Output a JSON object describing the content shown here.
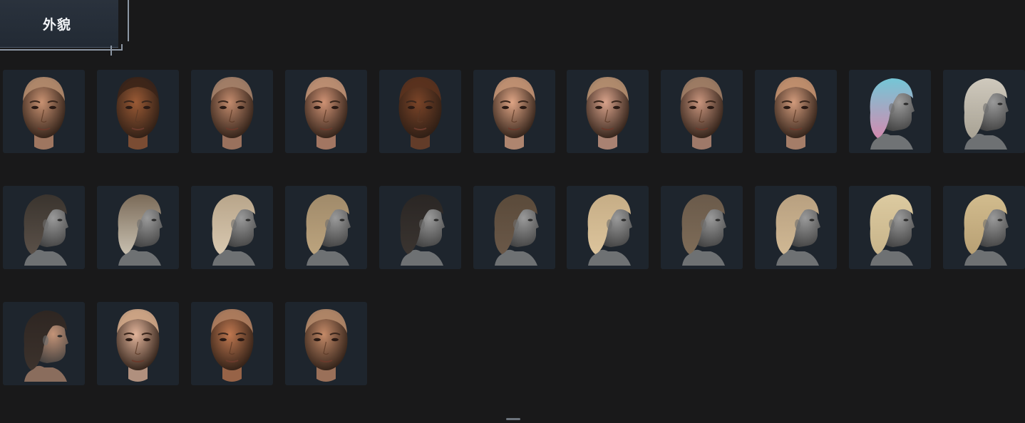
{
  "header": {
    "title": "外貌"
  },
  "colors": {
    "background": "#19191a",
    "tile": "#1e252d",
    "tab": "#262e38",
    "accent_line": "#8c96a3"
  },
  "rows": [
    {
      "name": "faces-row-1",
      "tiles": [
        {
          "kind": "face-front",
          "skin": "#c99272",
          "hair": "#b48c6e",
          "label_name": "head-option-1"
        },
        {
          "kind": "face-front",
          "skin": "#9a5a35",
          "hair": "#3a2418",
          "label_name": "head-option-2"
        },
        {
          "kind": "face-front",
          "skin": "#c38b6d",
          "hair": "#a5826a",
          "label_name": "head-option-3"
        },
        {
          "kind": "face-front",
          "skin": "#cf9274",
          "hair": "#c09276",
          "label_name": "head-option-4"
        },
        {
          "kind": "face-front",
          "skin": "#7a4428",
          "hair": "#5a321e",
          "label_name": "head-option-5"
        },
        {
          "kind": "face-front",
          "skin": "#dfa585",
          "hair": "#c39474",
          "label_name": "head-option-6"
        },
        {
          "kind": "face-front",
          "skin": "#d8a28a",
          "hair": "#b58f70",
          "label_name": "head-option-7"
        },
        {
          "kind": "face-front",
          "skin": "#c9957d",
          "hair": "#a07e66",
          "label_name": "head-option-8"
        },
        {
          "kind": "face-front",
          "skin": "#d29b7c",
          "hair": "#c49270",
          "label_name": "head-option-9"
        },
        {
          "kind": "hair-side",
          "skin": "#9c9c9c",
          "hair": "#74c6d6",
          "hair2": "#d38bb0",
          "label_name": "hairstyle-option-1"
        },
        {
          "kind": "hair-side",
          "skin": "#9a9a9a",
          "hair": "#cfc9bd",
          "hair2": "#a8a294",
          "label_name": "hairstyle-option-2"
        }
      ]
    },
    {
      "name": "hair-row-2",
      "tiles": [
        {
          "kind": "hair-side",
          "skin": "#9a9a9a",
          "hair": "#3a342e",
          "hair2": "#5a5048",
          "label_name": "hairstyle-option-3"
        },
        {
          "kind": "hair-side",
          "skin": "#9a9a9a",
          "hair": "#7a6a58",
          "hair2": "#c8c0b0",
          "label_name": "hairstyle-option-4"
        },
        {
          "kind": "hair-side",
          "skin": "#9a9a9a",
          "hair": "#b8a58a",
          "hair2": "#d8c8b0",
          "label_name": "hairstyle-option-5"
        },
        {
          "kind": "hair-side",
          "skin": "#9a9a9a",
          "hair": "#a08a6a",
          "hair2": "#bca47e",
          "label_name": "hairstyle-option-6"
        },
        {
          "kind": "hair-side",
          "skin": "#9a9a9a",
          "hair": "#2a2624",
          "hair2": "#3a3430",
          "label_name": "hairstyle-option-7"
        },
        {
          "kind": "hair-side",
          "skin": "#9a9a9a",
          "hair": "#5a4a3a",
          "hair2": "#6a5848",
          "label_name": "hairstyle-option-8"
        },
        {
          "kind": "hair-side",
          "skin": "#9a9a9a",
          "hair": "#c6ad86",
          "hair2": "#dcc49c",
          "label_name": "hairstyle-option-9"
        },
        {
          "kind": "hair-side",
          "skin": "#9a9a9a",
          "hair": "#6a5a4a",
          "hair2": "#7e6c58",
          "label_name": "hairstyle-option-10"
        },
        {
          "kind": "hair-side",
          "skin": "#9a9a9a",
          "hair": "#b8a080",
          "hair2": "#d0b894",
          "label_name": "hairstyle-option-11"
        },
        {
          "kind": "hair-side",
          "skin": "#9a9a9a",
          "hair": "#dccaa0",
          "hair2": "#c8b48a",
          "label_name": "hairstyle-option-12"
        },
        {
          "kind": "hair-side",
          "skin": "#9a9a9a",
          "hair": "#d2bc8e",
          "hair2": "#b8a074",
          "label_name": "hairstyle-option-13"
        }
      ]
    },
    {
      "name": "mixed-row-3",
      "tiles": [
        {
          "kind": "hair-side",
          "skin": "#c49478",
          "hair": "#2e2622",
          "hair2": "#3c322c",
          "label_name": "hairstyle-option-14"
        },
        {
          "kind": "face-front",
          "skin": "#e2b49a",
          "hair": "#d2a888",
          "label_name": "head-option-10"
        },
        {
          "kind": "face-front",
          "skin": "#c07850",
          "hair": "#b08060",
          "label_name": "head-option-11"
        },
        {
          "kind": "face-front",
          "skin": "#c48a68",
          "hair": "#b48a6a",
          "label_name": "head-option-12"
        }
      ]
    }
  ]
}
